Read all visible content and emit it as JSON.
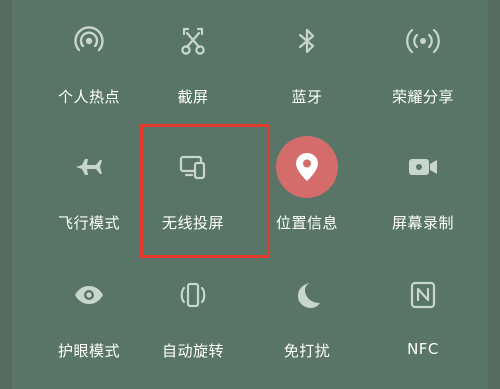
{
  "tiles": [
    {
      "id": "hotspot",
      "label": "个人热点",
      "icon": "hotspot-icon"
    },
    {
      "id": "screenshot",
      "label": "截屏",
      "icon": "scissors-icon"
    },
    {
      "id": "bluetooth",
      "label": "蓝牙",
      "icon": "bluetooth-icon"
    },
    {
      "id": "share",
      "label": "荣耀分享",
      "icon": "share-broadcast-icon"
    },
    {
      "id": "airplane",
      "label": "飞行模式",
      "icon": "airplane-icon"
    },
    {
      "id": "wireless-projection",
      "label": "无线投屏",
      "icon": "screen-cast-icon"
    },
    {
      "id": "location",
      "label": "位置信息",
      "icon": "location-pin-icon",
      "active": true
    },
    {
      "id": "screen-record",
      "label": "屏幕录制",
      "icon": "video-camera-icon"
    },
    {
      "id": "eye-comfort",
      "label": "护眼模式",
      "icon": "eye-icon"
    },
    {
      "id": "auto-rotate",
      "label": "自动旋转",
      "icon": "rotate-phone-icon"
    },
    {
      "id": "do-not-disturb",
      "label": "免打扰",
      "icon": "moon-icon"
    },
    {
      "id": "nfc",
      "label": "NFC",
      "icon": "nfc-icon"
    }
  ],
  "colors": {
    "panel": "#587567",
    "icon": "#c9d6cf",
    "active_bg": "#d56c6c",
    "highlight": "#e23b2c"
  }
}
